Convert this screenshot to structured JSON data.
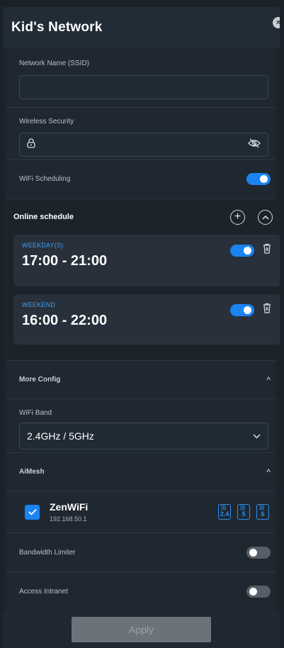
{
  "header": {
    "title": "Kid's Network",
    "close_glyph": "×"
  },
  "ssid": {
    "label": "Network Name (SSID)",
    "value": "",
    "placeholder": ""
  },
  "security": {
    "label": "Wireless Security",
    "value": ""
  },
  "scheduling": {
    "label": "WiFi Scheduling",
    "enabled": true
  },
  "schedule": {
    "title": "Online schedule",
    "items": [
      {
        "kind": "WEEKDAY(S)",
        "time": "17:00 - 21:00",
        "enabled": true
      },
      {
        "kind": "WEEKEND",
        "time": "16:00 - 22:00",
        "enabled": true
      }
    ]
  },
  "more_config": {
    "title": "More Config",
    "caret": "^"
  },
  "wifi_band": {
    "label": "WiFi Band",
    "value": "2.4GHz / 5GHz",
    "chevron": "⌄"
  },
  "aimesh": {
    "title": "AiMesh",
    "caret": "^",
    "node": {
      "name": "ZenWiFi",
      "ip": "192.168.50.1",
      "checked": true,
      "bands": [
        "2.4",
        "5",
        "6"
      ]
    }
  },
  "bandwidth_limiter": {
    "label": "Bandwidth Limiter",
    "enabled": false
  },
  "access_intranet": {
    "label": "Access Intranet",
    "enabled": false
  },
  "footer": {
    "apply_label": "Apply"
  },
  "colors": {
    "accent": "#1a84f0",
    "panel": "#1f2730",
    "card": "#28313b",
    "button_disabled": "#6b727a"
  }
}
